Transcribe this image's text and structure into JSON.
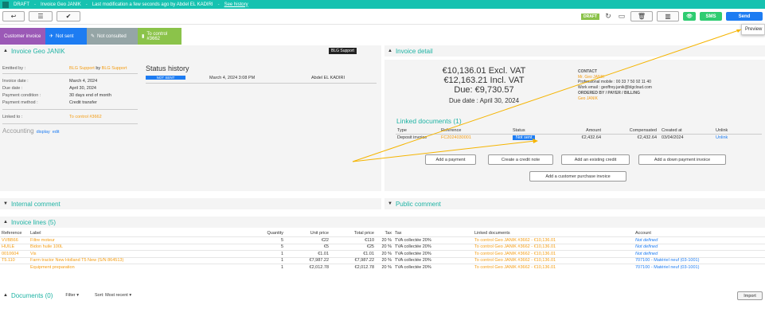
{
  "topbar": {
    "status": "DRAFT",
    "invoice_name": "Invoice Geo JANIK",
    "modification": "Last modification a few seconds ago by Abdel EL KADIRI",
    "history_link": "See history"
  },
  "toolbar": {
    "draft_badge": "DRAFT",
    "sms_label": "SMS",
    "send_label": "Send",
    "preview_label": "Preview"
  },
  "tabs": [
    {
      "label": "Customer invoice",
      "color": "#9b59b6"
    },
    {
      "label": "Not sent",
      "color": "#1d7cf2"
    },
    {
      "label": "Not consulted",
      "color": "#95a5a6"
    },
    {
      "label": "To control\n#3662",
      "color": "#8bc34a"
    }
  ],
  "left_panel": {
    "title": "Invoice Geo JANIK",
    "support_badge": "BLG Support",
    "emitted_by_label": "Emitted by :",
    "emitted_by_a": "BLG Support",
    "emitted_by_by": "by",
    "emitted_by_b": "BLG Support",
    "invoice_date_label": "Invoice date :",
    "invoice_date": "March 4, 2024",
    "due_date_label": "Due date :",
    "due_date": "April 30, 2024",
    "payment_condition_label": "Payment condition :",
    "payment_condition": "30 days end of month",
    "payment_method_label": "Payment method :",
    "payment_method": "Credit transfer",
    "linked_to_label": "Linked to :",
    "linked_to": "To control #3662",
    "accounting_label": "Accounting",
    "accounting_display": "display",
    "accounting_edit": "edit",
    "status_history_title": "Status history",
    "status_history": {
      "status": "NOT SENT",
      "date": "March 4, 2024 3:08 PM",
      "user": "Abdel EL KADIRI"
    }
  },
  "right_panel": {
    "title": "Invoice detail",
    "excl_vat": "€10,136.01 Excl. VAT",
    "incl_vat": "€12,163.21 Incl. VAT",
    "due": "Due: €9,730.57",
    "due_date": "Due date : April 30, 2024",
    "contact_header": "CONTACT",
    "contact_name": "Mr. Geo JANIK",
    "contact_mobile": "Professional mobile : 00 33 7 50 92 11 40",
    "contact_email": "Work email : geoffrey.janik@blgcloud.com",
    "ordered_header": "ORDERED BY / PAYER / BILLING",
    "ordered_name": "Geo JANIK",
    "linked_docs_title": "Linked documents (1)",
    "linked_columns": [
      "Type",
      "Reference",
      "Status",
      "Amount",
      "Compensated",
      "Created at",
      "Unlink"
    ],
    "linked_row": {
      "type": "Deposit invoice",
      "reference": "FC2024030001",
      "status": "Not sent",
      "amount": "€2,432.64",
      "compensated": "€2,432.64",
      "created_at": "03/04/2024",
      "unlink": "Unlink"
    },
    "buttons": {
      "add_payment": "Add a payment",
      "create_credit": "Create a credit note",
      "add_existing_credit": "Add an existing credit",
      "add_down_payment": "Add a down payment invoice",
      "add_customer_purchase": "Add a customer purchase invoice"
    }
  },
  "sections": {
    "internal_comment": "Internal comment",
    "public_comment": "Public comment",
    "invoice_lines": "Invoice lines (5)",
    "documents": "Documents (0)",
    "filter": "Filter",
    "sort": "Sort: Most recent",
    "import": "Import"
  },
  "lines_columns": [
    "Reference",
    "Label",
    "Quantity",
    "Unit price",
    "Total price",
    "Tax",
    "Tax",
    "Linked documents",
    "Account"
  ],
  "lines": [
    {
      "ref": "VVBB66",
      "label": "Filtre moteur",
      "qty": "5",
      "unit": "€22",
      "total": "€110",
      "tax_rate": "20 %",
      "tax": "TVA collectée 20%",
      "linked": "To control Geo JANIK #3662 - €10,136.01",
      "account": "Not defined"
    },
    {
      "ref": "HUILE",
      "label": "Bidon huile 100L",
      "qty": "5",
      "unit": "€5",
      "total": "€25",
      "tax_rate": "20 %",
      "tax": "TVA collectée 20%",
      "linked": "To control Geo JANIK #3662 - €10,136.01",
      "account": "Not defined"
    },
    {
      "ref": "0010604",
      "label": "Vis",
      "qty": "1",
      "unit": "€1.01",
      "total": "€1.01",
      "tax_rate": "20 %",
      "tax": "TVA collectée 20%",
      "linked": "To control Geo JANIK #3662 - €10,136.01",
      "account": "Not defined"
    },
    {
      "ref": "T5.110",
      "label": "Farm tractor New Holland T5 New (S/N 864513)",
      "qty": "1",
      "unit": "€7,987.22",
      "total": "€7,987.22",
      "tax_rate": "20 %",
      "tax": "TVA collectée 20%",
      "linked": "To control Geo JANIK #3662 - €10,136.01",
      "account": "707100 - Matériel neuf (03-1001)"
    },
    {
      "ref": "",
      "label": "Equipment preparation",
      "qty": "1",
      "unit": "€2,012.78",
      "total": "€2,012.78",
      "tax_rate": "20 %",
      "tax": "TVA collectée 20%",
      "linked": "To control Geo JANIK #3662 - €10,136.01",
      "account": "707100 - Matériel neuf (03-1001)"
    }
  ]
}
